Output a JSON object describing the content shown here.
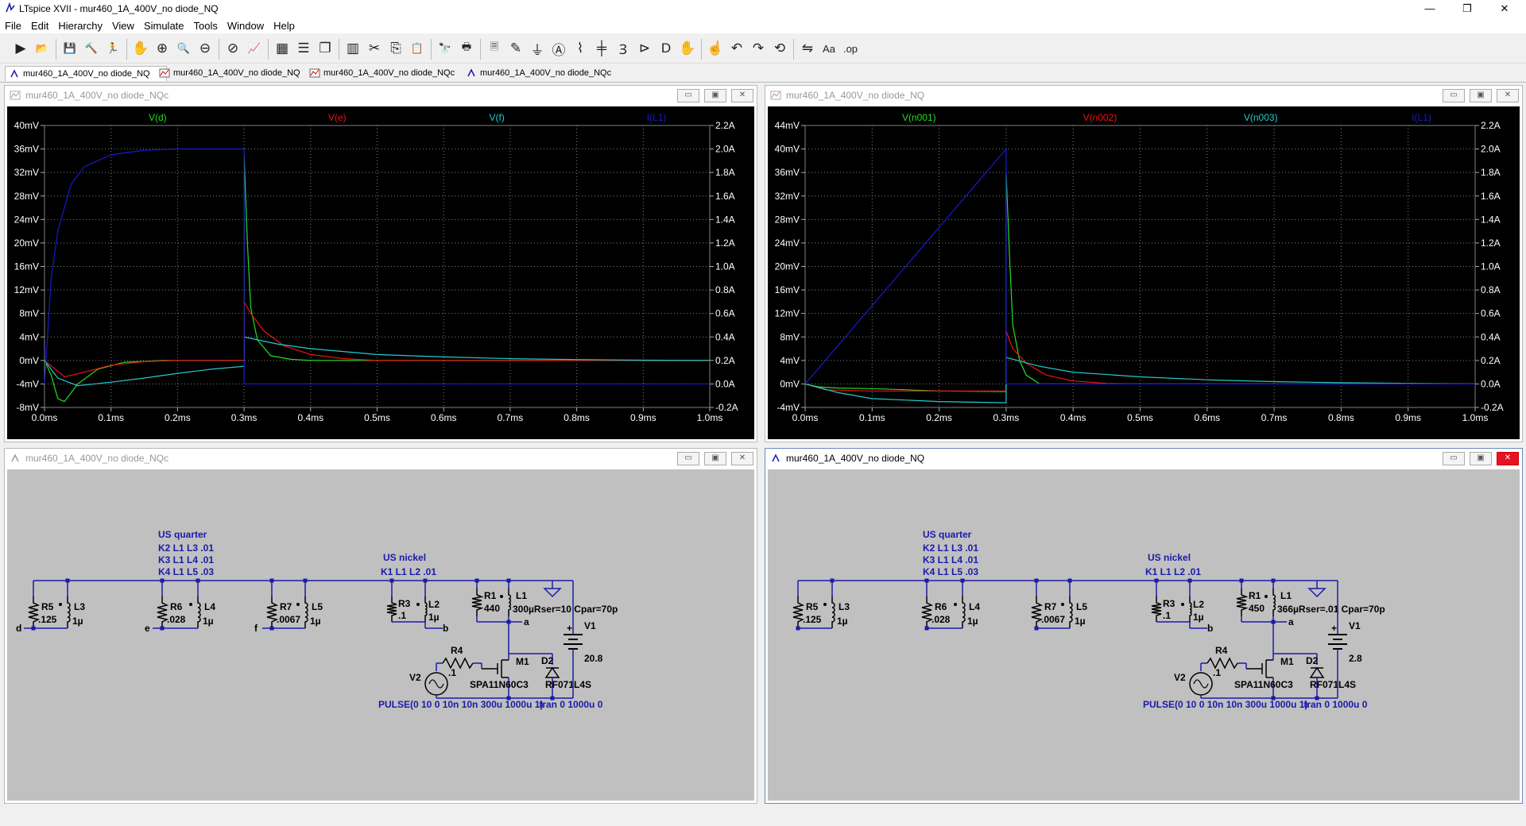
{
  "app": {
    "title": "LTspice XVII - mur460_1A_400V_no diode_NQ",
    "controls": [
      "—",
      "❐",
      "✕"
    ]
  },
  "menu": [
    "File",
    "Edit",
    "Hierarchy",
    "View",
    "Simulate",
    "Tools",
    "Window",
    "Help"
  ],
  "toolbar": [
    {
      "name": "run-icon",
      "glyph": "▶"
    },
    {
      "name": "open-icon",
      "glyph": "📂"
    },
    {
      "name": "save-icon",
      "glyph": "💾"
    },
    {
      "name": "control-panel-icon",
      "glyph": "🔨"
    },
    {
      "name": "halt-icon",
      "glyph": "🏃"
    },
    {
      "name": "pan-icon",
      "glyph": "✋"
    },
    {
      "name": "zoom-in-icon",
      "glyph": "⊕"
    },
    {
      "name": "zoom-area-icon",
      "glyph": "🔍"
    },
    {
      "name": "zoom-out-icon",
      "glyph": "⊖"
    },
    {
      "name": "zoom-cancel-icon",
      "glyph": "⊘"
    },
    {
      "name": "autorange-icon",
      "glyph": "📈"
    },
    {
      "name": "grid-icon",
      "glyph": "▦"
    },
    {
      "name": "tile-horizontal-icon",
      "glyph": "☰"
    },
    {
      "name": "cascade-icon",
      "glyph": "❐"
    },
    {
      "name": "tile-vertical-icon",
      "glyph": "▥"
    },
    {
      "name": "cut-icon",
      "glyph": "✂"
    },
    {
      "name": "copy-icon",
      "glyph": "⎘"
    },
    {
      "name": "paste-icon",
      "glyph": "📋"
    },
    {
      "name": "find-icon",
      "glyph": "🔭"
    },
    {
      "name": "print-icon",
      "glyph": "🖶"
    },
    {
      "name": "print-preview-icon",
      "glyph": "🗏"
    },
    {
      "name": "wire-icon",
      "glyph": "✎"
    },
    {
      "name": "ground-icon",
      "glyph": "⏚"
    },
    {
      "name": "label-net-icon",
      "glyph": "Ⓐ"
    },
    {
      "name": "resistor-icon",
      "glyph": "⌇"
    },
    {
      "name": "capacitor-icon",
      "glyph": "╪"
    },
    {
      "name": "inductor-icon",
      "glyph": "Ɜ"
    },
    {
      "name": "diode-icon",
      "glyph": "⊳"
    },
    {
      "name": "component-icon",
      "glyph": "D"
    },
    {
      "name": "move-icon",
      "glyph": "✋"
    },
    {
      "name": "drag-icon",
      "glyph": "☝"
    },
    {
      "name": "undo-icon",
      "glyph": "↶"
    },
    {
      "name": "redo-icon",
      "glyph": "↷"
    },
    {
      "name": "rotate-icon",
      "glyph": "⟲"
    },
    {
      "name": "mirror-icon",
      "glyph": "⇋"
    },
    {
      "name": "text-icon",
      "glyph": "Aa"
    },
    {
      "name": "spice-directive-icon",
      "glyph": ".op"
    }
  ],
  "tabs": [
    {
      "label": "mur460_1A_400V_no diode_NQ",
      "kind": "schematic"
    },
    {
      "label": "mur460_1A_400V_no diode_NQ",
      "kind": "waveform"
    },
    {
      "label": "mur460_1A_400V_no diode_NQc",
      "kind": "waveform"
    },
    {
      "label": "mur460_1A_400V_no diode_NQc",
      "kind": "schematic"
    }
  ],
  "windows": {
    "plot_left": {
      "title": "mur460_1A_400V_no diode_NQc"
    },
    "plot_right": {
      "title": "mur460_1A_400V_no diode_NQ"
    },
    "schem_left": {
      "title": "mur460_1A_400V_no diode_NQc"
    },
    "schem_right": {
      "title": "mur460_1A_400V_no diode_NQ"
    }
  },
  "chart_data": [
    {
      "type": "line",
      "title": "",
      "x_ticks": [
        "0.0ms",
        "0.1ms",
        "0.2ms",
        "0.3ms",
        "0.4ms",
        "0.5ms",
        "0.6ms",
        "0.7ms",
        "0.8ms",
        "0.9ms",
        "1.0ms"
      ],
      "xlim": [
        0,
        1.0
      ],
      "y_left_ticks": [
        "40mV",
        "36mV",
        "32mV",
        "28mV",
        "24mV",
        "20mV",
        "16mV",
        "12mV",
        "8mV",
        "4mV",
        "0mV",
        "-4mV",
        "-8mV"
      ],
      "ylim_left": [
        -8,
        40
      ],
      "y_right_ticks": [
        "2.2A",
        "2.0A",
        "1.8A",
        "1.6A",
        "1.4A",
        "1.2A",
        "1.0A",
        "0.8A",
        "0.6A",
        "0.4A",
        "0.2A",
        "0.0A",
        "-0.2A"
      ],
      "ylim_right": [
        -0.2,
        2.2
      ],
      "series": [
        {
          "name": "V(d)",
          "color": "#22dd22",
          "axis": "left",
          "x": [
            0,
            0.01,
            0.02,
            0.03,
            0.05,
            0.08,
            0.12,
            0.18,
            0.25,
            0.3,
            0.3,
            0.305,
            0.31,
            0.32,
            0.34,
            0.37,
            0.4,
            0.45,
            0.5,
            1.0
          ],
          "y": [
            0,
            -2.5,
            -6.5,
            -7,
            -4,
            -1.5,
            -0.3,
            0,
            0,
            0,
            35,
            20,
            9,
            3.5,
            0.8,
            0.2,
            0,
            0,
            0,
            0
          ]
        },
        {
          "name": "V(e)",
          "color": "#ee1111",
          "axis": "left",
          "x": [
            0,
            0.03,
            0.06,
            0.1,
            0.15,
            0.2,
            0.3,
            0.3,
            0.31,
            0.33,
            0.36,
            0.4,
            0.45,
            0.5,
            0.6,
            1.0
          ],
          "y": [
            0,
            -2.8,
            -2,
            -0.8,
            -0.2,
            0,
            0,
            10,
            8,
            5,
            2.5,
            1,
            0.3,
            0,
            0,
            0
          ],
          "note": ""
        },
        {
          "name": "V(f)",
          "color": "#22cccc",
          "axis": "left",
          "x": [
            0,
            0.02,
            0.05,
            0.1,
            0.15,
            0.2,
            0.25,
            0.3,
            0.3,
            0.35,
            0.4,
            0.5,
            0.6,
            0.7,
            0.8,
            0.9,
            1.0
          ],
          "y": [
            0,
            -3,
            -4.3,
            -3.7,
            -3,
            -2.2,
            -1.5,
            -1,
            4,
            2.8,
            2,
            1,
            0.6,
            0.3,
            0.15,
            0.05,
            0
          ]
        },
        {
          "name": "I(L1)",
          "color": "#1a1acc",
          "axis": "right",
          "x": [
            0,
            0.01,
            0.02,
            0.04,
            0.06,
            0.1,
            0.15,
            0.2,
            0.3,
            0.3,
            1.0
          ],
          "y": [
            0,
            0.9,
            1.3,
            1.7,
            1.85,
            1.95,
            1.99,
            2.0,
            2.0,
            0,
            0
          ]
        }
      ]
    },
    {
      "type": "line",
      "title": "",
      "x_ticks": [
        "0.0ms",
        "0.1ms",
        "0.2ms",
        "0.3ms",
        "0.4ms",
        "0.5ms",
        "0.6ms",
        "0.7ms",
        "0.8ms",
        "0.9ms",
        "1.0ms"
      ],
      "xlim": [
        0,
        1.0
      ],
      "y_left_ticks": [
        "44mV",
        "40mV",
        "36mV",
        "32mV",
        "28mV",
        "24mV",
        "20mV",
        "16mV",
        "12mV",
        "8mV",
        "4mV",
        "0mV",
        "-4mV"
      ],
      "ylim_left": [
        -4,
        44
      ],
      "y_right_ticks": [
        "2.2A",
        "2.0A",
        "1.8A",
        "1.6A",
        "1.4A",
        "1.2A",
        "1.0A",
        "0.8A",
        "0.6A",
        "0.4A",
        "0.2A",
        "0.0A",
        "-0.2A"
      ],
      "ylim_right": [
        -0.2,
        2.2
      ],
      "series": [
        {
          "name": "V(n001)",
          "color": "#22dd22",
          "axis": "left",
          "x": [
            0,
            0.02,
            0.05,
            0.1,
            0.2,
            0.3,
            0.3,
            0.305,
            0.31,
            0.32,
            0.33,
            0.35,
            1.0
          ],
          "y": [
            0,
            -0.5,
            -0.7,
            -0.8,
            -1.2,
            -1.3,
            36,
            22,
            10,
            4,
            1.5,
            0,
            0
          ]
        },
        {
          "name": "V(n002)",
          "color": "#ee1111",
          "axis": "left",
          "x": [
            0,
            0.03,
            0.1,
            0.2,
            0.3,
            0.3,
            0.31,
            0.33,
            0.36,
            0.4,
            0.45,
            0.5,
            1.0
          ],
          "y": [
            0,
            -1,
            -1.2,
            -1.2,
            -1.2,
            9,
            6,
            3.5,
            1.5,
            0.5,
            0.1,
            0,
            0
          ]
        },
        {
          "name": "V(n003)",
          "color": "#22cccc",
          "axis": "left",
          "x": [
            0,
            0.05,
            0.1,
            0.2,
            0.3,
            0.3,
            0.35,
            0.4,
            0.5,
            0.6,
            0.7,
            0.8,
            0.9,
            1.0
          ],
          "y": [
            0,
            -1.5,
            -2.5,
            -3,
            -3.2,
            4.5,
            3,
            2,
            1.2,
            0.7,
            0.4,
            0.2,
            0.1,
            0
          ]
        },
        {
          "name": "I(L1)",
          "color": "#1a1acc",
          "axis": "right",
          "x": [
            0,
            0.3,
            0.3,
            1.0
          ],
          "y": [
            0,
            2.0,
            0,
            0
          ]
        }
      ]
    }
  ],
  "schematic_left": {
    "us_quarter": "US quarter",
    "k_lines": [
      "K2 L1 L3 .01",
      "K3 L1 L4 .01",
      "K4 L1 L5 .03"
    ],
    "us_nickel": "US nickel",
    "k1": "K1 L1 L2 .01",
    "r5": "R5",
    "r5v": ".125",
    "l3": "L3",
    "l3v": "1µ",
    "d": "d",
    "r6": "R6",
    "r6v": ".028",
    "l4": "L4",
    "l4v": "1µ",
    "e": "e",
    "r7": "R7",
    "r7v": ".0067",
    "l5": "L5",
    "l5v": "1µ",
    "f": "f",
    "r3": "R3",
    "r3v": ".1",
    "l2": "L2",
    "l2v": "1µ",
    "b": "b",
    "r1": "R1",
    "r1v": "440",
    "l1": "L1",
    "l1v": "300µRser=10 Cpar=70p",
    "a": "a",
    "v1": "V1",
    "v1v": "20.8",
    "r4": "R4",
    "r4v": ".1",
    "v2": "V2",
    "m1": "M1",
    "m1v": "SPA11N60C3",
    "d2": "D2",
    "d2v": "RF071L4S",
    "pulse": "PULSE(0 10 0 10n 10n 300u 1000u 1)",
    "tran": ".tran 0 1000u 0"
  },
  "schematic_right": {
    "us_quarter": "US quarter",
    "k_lines": [
      "K2 L1 L3 .01",
      "K3 L1 L4 .01",
      "K4 L1 L5 .03"
    ],
    "us_nickel": "US nickel",
    "k1": "K1 L1 L2 .01",
    "r5": "R5",
    "r5v": ".125",
    "l3": "L3",
    "l3v": "1µ",
    "r6": "R6",
    "r6v": ".028",
    "l4": "L4",
    "l4v": "1µ",
    "r7": "R7",
    "r7v": ".0067",
    "l5": "L5",
    "l5v": "1µ",
    "r3": "R3",
    "r3v": ".1",
    "l2": "L2",
    "l2v": "1µ",
    "b": "b",
    "r1": "R1",
    "r1v": "450",
    "l1": "L1",
    "l1v": "366µRser=.01 Cpar=70p",
    "a": "a",
    "v1": "V1",
    "v1v": "2.8",
    "r4": "R4",
    "r4v": ".1",
    "v2": "V2",
    "m1": "M1",
    "m1v": "SPA11N60C3",
    "d2": "D2",
    "d2v": "RF071L4S",
    "pulse": "PULSE(0 10 0 10n 10n 300u 1000u 1)",
    "tran": ".tran 0 1000u 0"
  }
}
